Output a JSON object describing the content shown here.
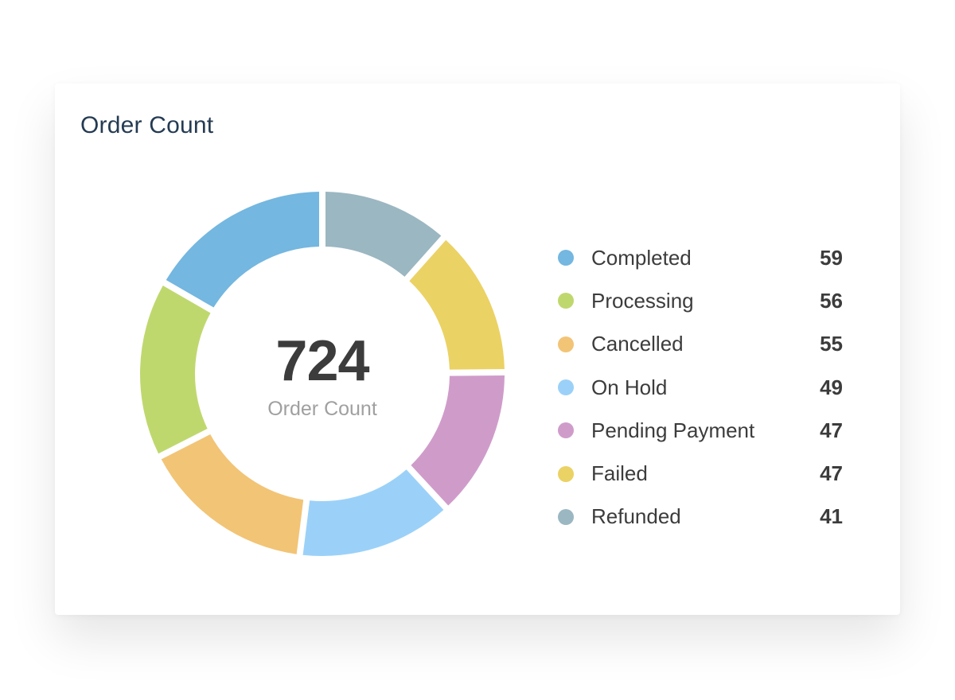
{
  "card": {
    "title": "Order Count"
  },
  "center": {
    "value": "724",
    "label": "Order Count"
  },
  "chart_data": {
    "type": "pie",
    "variant": "donut",
    "title": "Order Count",
    "total_label": "Order Count",
    "total_value": 724,
    "direction": "counterclockwise-from-top",
    "legend_position": "right",
    "categories": [
      "Completed",
      "Processing",
      "Cancelled",
      "On Hold",
      "Pending Payment",
      "Failed",
      "Refunded"
    ],
    "values": [
      59,
      56,
      55,
      49,
      47,
      47,
      41
    ],
    "colors": [
      "#74b7e0",
      "#bfd86e",
      "#f2c476",
      "#9bd1f8",
      "#cf9cca",
      "#ebd264",
      "#9bb7c1"
    ]
  },
  "legend": [
    {
      "label": "Completed",
      "value": "59",
      "color": "#74b7e0"
    },
    {
      "label": "Processing",
      "value": "56",
      "color": "#bfd86e"
    },
    {
      "label": "Cancelled",
      "value": "55",
      "color": "#f2c476"
    },
    {
      "label": "On Hold",
      "value": "49",
      "color": "#9bd1f8"
    },
    {
      "label": "Pending Payment",
      "value": "47",
      "color": "#cf9cca"
    },
    {
      "label": "Failed",
      "value": "47",
      "color": "#ebd264"
    },
    {
      "label": "Refunded",
      "value": "41",
      "color": "#9bb7c1"
    }
  ]
}
